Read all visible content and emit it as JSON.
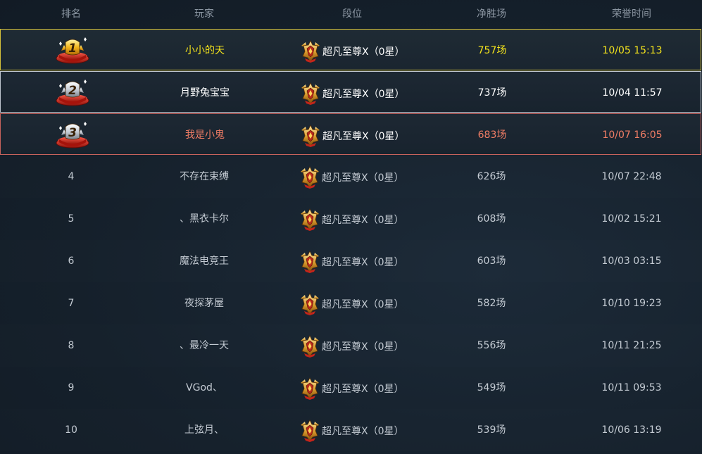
{
  "header": {
    "rank": "排名",
    "player": "玩家",
    "tier": "段位",
    "net_wins": "净胜场",
    "honor_time": "荣誉时间"
  },
  "colors": {
    "gold": "#f2e21c",
    "silver": "#ffffff",
    "bronze": "#f07d65",
    "default_text": "#c4cbd3",
    "header_text": "#8b96a2"
  },
  "rows": [
    {
      "rank": "1",
      "player": "小小的天",
      "tier": "超凡至尊Ⅹ（0星）",
      "wins": "757场",
      "time": "10/05 15:13"
    },
    {
      "rank": "2",
      "player": "月野兔宝宝",
      "tier": "超凡至尊Ⅹ（0星）",
      "wins": "737场",
      "time": "10/04 11:57"
    },
    {
      "rank": "3",
      "player": "我是小鬼",
      "tier": "超凡至尊Ⅹ（0星）",
      "wins": "683场",
      "time": "10/07 16:05"
    },
    {
      "rank": "4",
      "player": "不存在束缚",
      "tier": "超凡至尊Ⅹ（0星）",
      "wins": "626场",
      "time": "10/07 22:48"
    },
    {
      "rank": "5",
      "player": "、黑衣卡尔",
      "tier": "超凡至尊Ⅹ（0星）",
      "wins": "608场",
      "time": "10/02 15:21"
    },
    {
      "rank": "6",
      "player": "魔法电竞王",
      "tier": "超凡至尊Ⅹ（0星）",
      "wins": "603场",
      "time": "10/03 03:15"
    },
    {
      "rank": "7",
      "player": "夜探茅屋",
      "tier": "超凡至尊Ⅹ（0星）",
      "wins": "582场",
      "time": "10/10 19:23"
    },
    {
      "rank": "8",
      "player": "、最冷一天",
      "tier": "超凡至尊Ⅹ（0星）",
      "wins": "556场",
      "time": "10/11 21:25"
    },
    {
      "rank": "9",
      "player": "VGod、",
      "tier": "超凡至尊Ⅹ（0星）",
      "wins": "549场",
      "time": "10/11 09:53"
    },
    {
      "rank": "10",
      "player": "上弦月、",
      "tier": "超凡至尊Ⅹ（0星）",
      "wins": "539场",
      "time": "10/06 13:19"
    }
  ],
  "icons": {
    "tier": "tier-emblem-icon",
    "medal_gold": "gold-medal-icon",
    "medal_silver": "silver-medal-icon",
    "medal_bronze": "bronze-medal-icon"
  }
}
